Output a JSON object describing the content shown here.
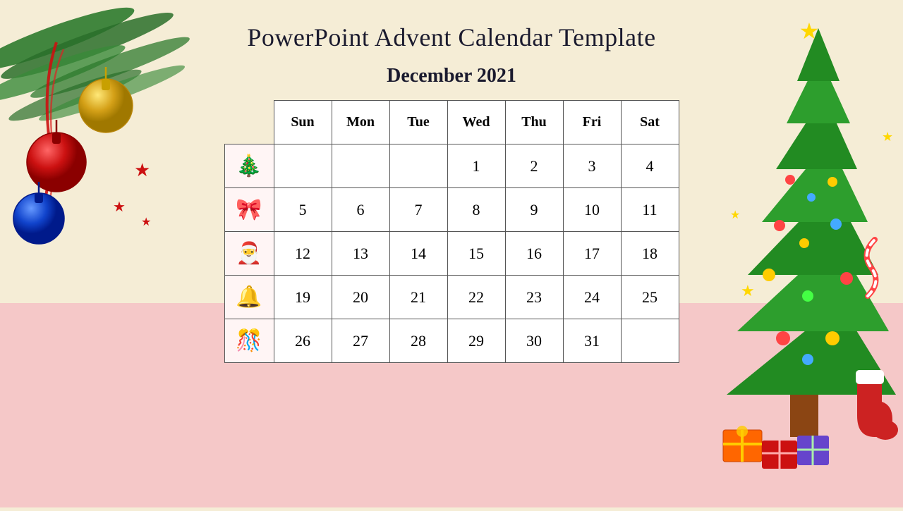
{
  "page": {
    "title": "PowerPoint Advent Calendar Template",
    "month": "December 2021",
    "bg_top_color": "#f5edd6",
    "bg_bottom_color": "#f5c8c8"
  },
  "calendar": {
    "headers": [
      "Sun",
      "Mon",
      "Tue",
      "Wed",
      "Thu",
      "Fri",
      "Sat"
    ],
    "rows": [
      {
        "icon": "🎄",
        "days": [
          "",
          "",
          "",
          "1",
          "2",
          "3",
          "4"
        ]
      },
      {
        "icon": "🎀",
        "days": [
          "5",
          "6",
          "7",
          "8",
          "9",
          "10",
          "11"
        ]
      },
      {
        "icon": "🎅",
        "days": [
          "12",
          "13",
          "14",
          "15",
          "16",
          "17",
          "18"
        ]
      },
      {
        "icon": "🔔",
        "days": [
          "19",
          "20",
          "21",
          "22",
          "23",
          "24",
          "25"
        ]
      },
      {
        "icon": "🎊",
        "days": [
          "26",
          "27",
          "28",
          "29",
          "30",
          "31",
          ""
        ]
      }
    ]
  }
}
